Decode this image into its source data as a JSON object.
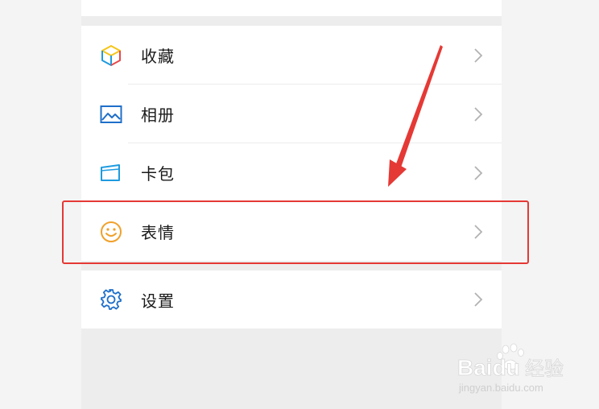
{
  "menu": {
    "items": [
      {
        "label": "收藏",
        "icon": "favorites-cube-icon"
      },
      {
        "label": "相册",
        "icon": "album-picture-icon"
      },
      {
        "label": "卡包",
        "icon": "card-wallet-icon"
      },
      {
        "label": "表情",
        "icon": "sticker-smiley-icon"
      }
    ],
    "settings": {
      "label": "设置",
      "icon": "gear-icon"
    }
  },
  "annotation": {
    "highlight_color": "#e53935",
    "highlighted_item": "表情"
  },
  "watermark": {
    "brand": "Baidu",
    "suffix": "经验",
    "url": "jingyan.baidu.com"
  },
  "colors": {
    "icon_blue": "#1e6fc9",
    "icon_orange": "#f0a12b",
    "icon_red": "#e5484d",
    "icon_yellow": "#f5c518",
    "chevron": "#b2b2b2"
  }
}
